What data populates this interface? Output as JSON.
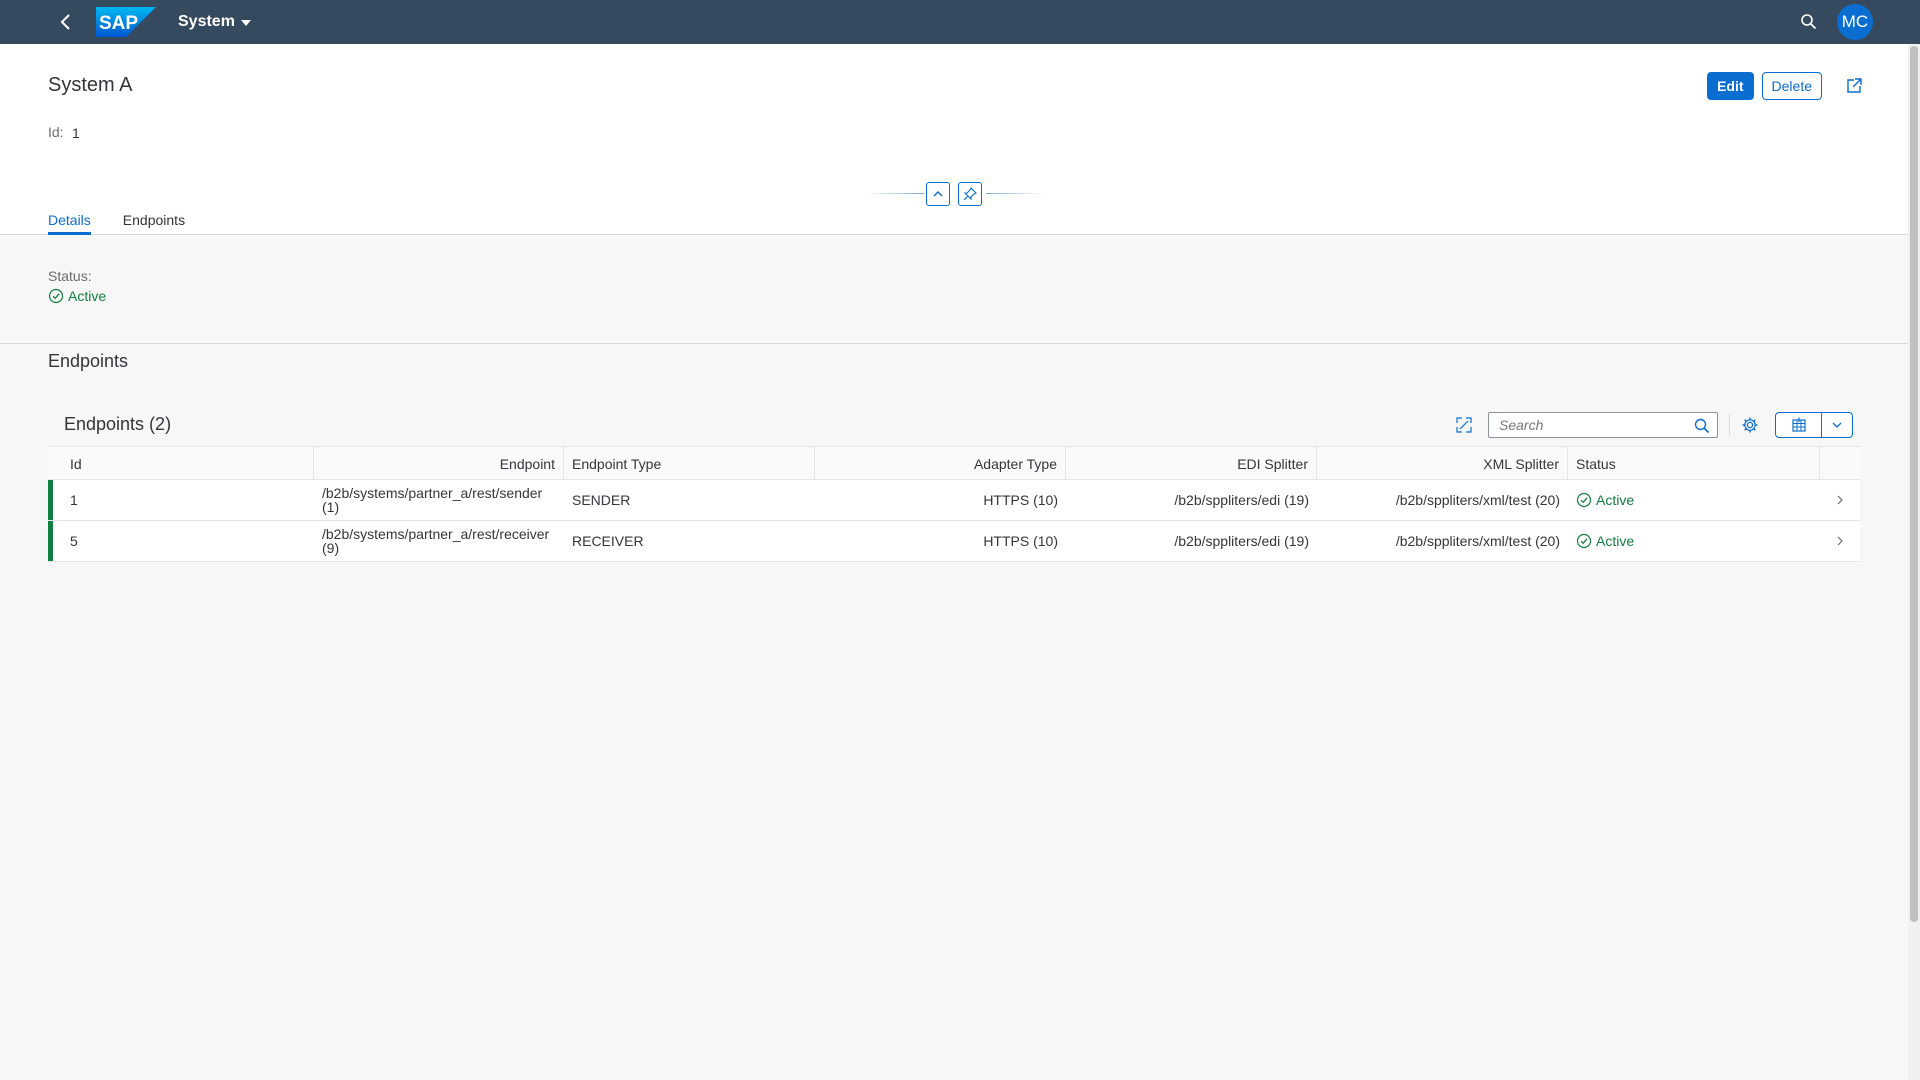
{
  "shell": {
    "logo_text": "SAP",
    "title": "System",
    "avatar_initials": "MC"
  },
  "header": {
    "title": "System A",
    "id_label": "Id:",
    "id_value": "1",
    "edit_label": "Edit",
    "delete_label": "Delete"
  },
  "tabs": [
    {
      "label": "Details",
      "active": true
    },
    {
      "label": "Endpoints",
      "active": false
    }
  ],
  "details": {
    "status_label": "Status:",
    "status_value": "Active"
  },
  "endpoints": {
    "section_title": "Endpoints",
    "table_title": "Endpoints (2)",
    "search_placeholder": "Search",
    "columns": [
      "Id",
      "Endpoint",
      "Endpoint Type",
      "Adapter Type",
      "EDI Splitter",
      "XML Splitter",
      "Status"
    ],
    "rows": [
      {
        "id": "1",
        "endpoint_path": "/b2b/systems/partner_a/rest/sender",
        "endpoint_id": "(1)",
        "endpoint_type": "SENDER",
        "adapter_type": "HTTPS (10)",
        "edi_splitter": "/b2b/sppliters/edi (19)",
        "xml_splitter": "/b2b/sppliters/xml/test (20)",
        "status": "Active"
      },
      {
        "id": "5",
        "endpoint_path": "/b2b/systems/partner_a/rest/receiver",
        "endpoint_id": "(9)",
        "endpoint_type": "RECEIVER",
        "adapter_type": "HTTPS (10)",
        "edi_splitter": "/b2b/sppliters/edi (19)",
        "xml_splitter": "/b2b/sppliters/xml/test (20)",
        "status": "Active"
      }
    ]
  },
  "colors": {
    "shell_bg": "#354a5f",
    "accent": "#0a6ed1",
    "positive": "#107e3e"
  },
  "icons": [
    "back-arrow-icon",
    "sap-logo",
    "search-icon",
    "collapse-header-icon",
    "pin-icon",
    "share-icon",
    "fullscreen-icon",
    "settings-icon",
    "export-icon",
    "chevron-down-icon",
    "check-circle-icon",
    "chevron-right-icon"
  ]
}
